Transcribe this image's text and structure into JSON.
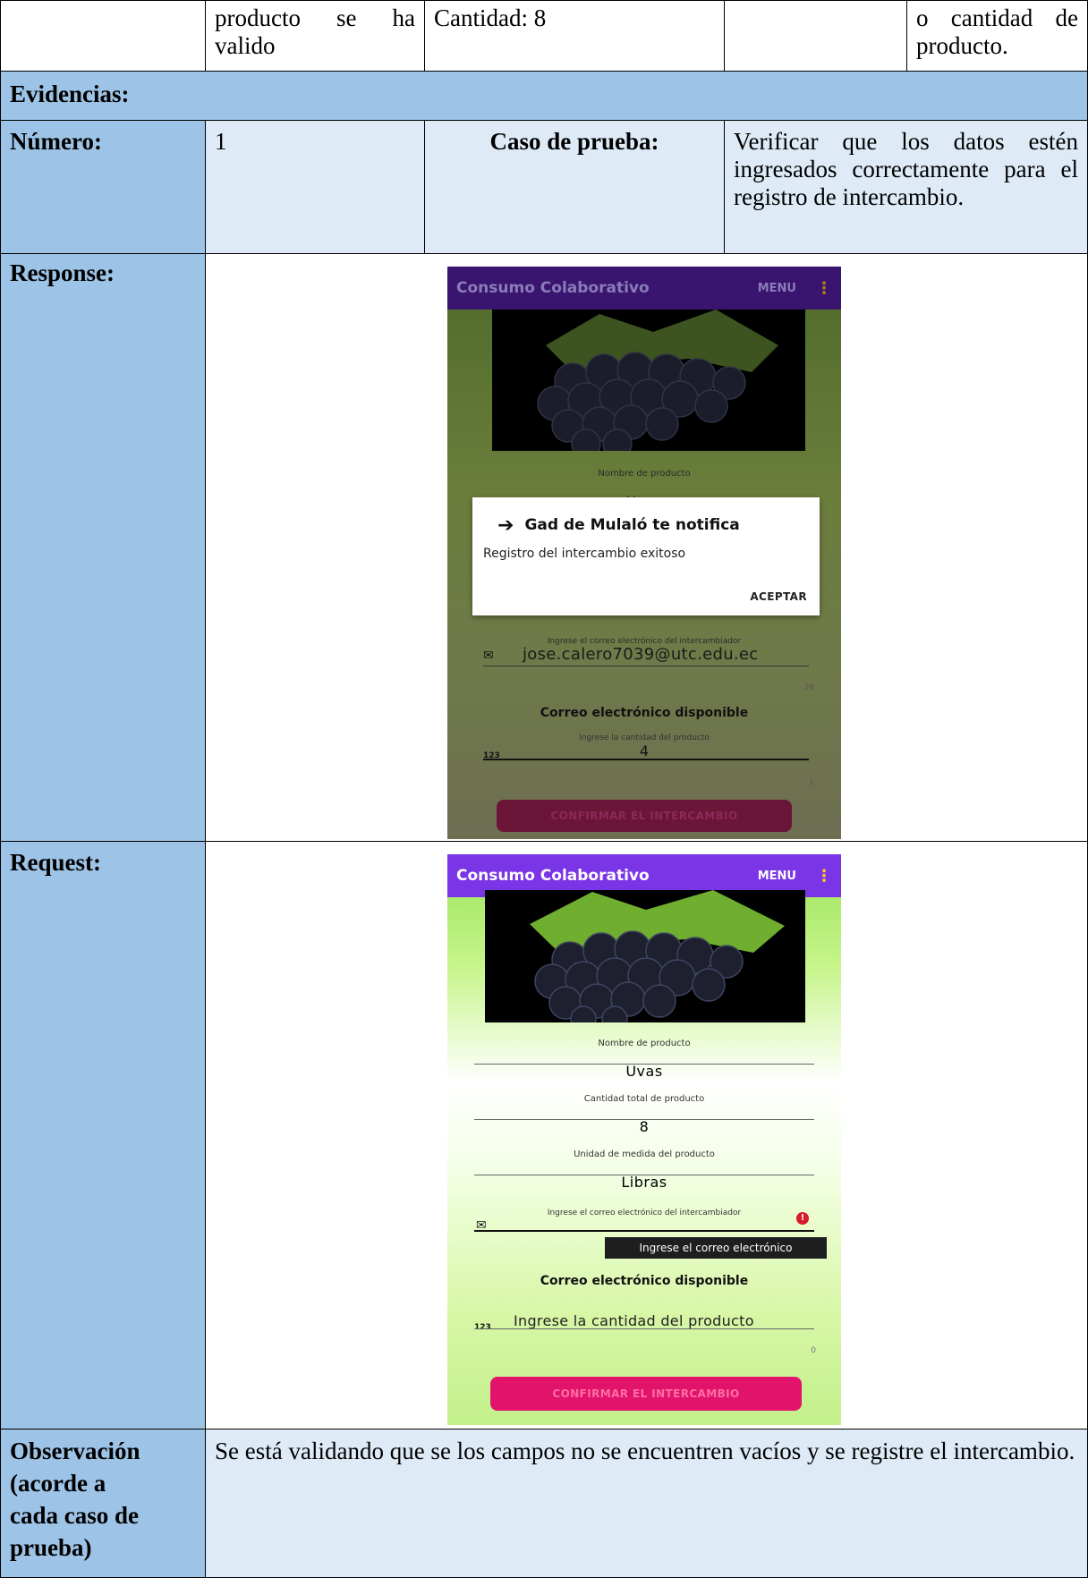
{
  "top_row": {
    "col2": "producto se ha valido",
    "col3": "Cantidad: 8",
    "col4": "",
    "col5": "o cantidad de producto."
  },
  "evidencias_label": "Evidencias:",
  "numero": {
    "label": "Número:",
    "value": "1",
    "caso_label": "Caso de prueba:",
    "caso_value": "Verificar que los datos estén ingresados correctamente para el registro de intercambio."
  },
  "response": {
    "label": "Response:",
    "app_title": "Consumo Colaborativo",
    "menu_label": "MENU",
    "product_name_label": "Nombre de producto",
    "product_name_value": "Uvas",
    "dialog_title": "Gad de Mulaló te notifica",
    "dialog_message": "Registro del intercambio exitoso",
    "dialog_button": "ACEPTAR",
    "email_label": "Ingrese el correo electrónico del intercambiador",
    "email_value": "jose.calero7039@utc.edu.ec",
    "email_counter": "26",
    "email_status": "Correo electrónico disponible",
    "quantity_label": "Ingrese la cantidad del producto",
    "quantity_value": "4",
    "quantity_counter": "1",
    "confirm_button": "CONFIRMAR EL INTERCAMBIO"
  },
  "request": {
    "label": "Request:",
    "app_title": "Consumo Colaborativo",
    "menu_label": "MENU",
    "product_name_label": "Nombre de producto",
    "product_name_value": "Uvas",
    "total_label": "Cantidad total de producto",
    "total_value": "8",
    "unit_label": "Unidad de medida del producto",
    "unit_value": "Libras",
    "email_label": "Ingrese el correo electrónico del intercambiador",
    "error_tooltip": "Ingrese el correo electrónico",
    "email_status": "Correo electrónico disponible",
    "quantity_placeholder": "Ingrese la cantidad del producto",
    "quantity_counter": "0",
    "confirm_button": "CONFIRMAR EL INTERCAMBIO"
  },
  "observacion": {
    "label_line1": "Observación",
    "label_line2": "(acorde a",
    "label_line3": "cada caso de",
    "label_line4": "prueba)",
    "text": "Se está validando que se los campos no se encuentren vacíos y se registre el intercambio."
  },
  "colors": {
    "header_blue": "#9dc3e6",
    "light_blue": "#deebf7",
    "appbar_purple": "#6a2ad8",
    "confirm_pink": "#e2136b"
  },
  "icons": [
    "arrow-right-icon",
    "email-icon",
    "numeric-123-icon",
    "error-icon",
    "overflow-dots-icon"
  ]
}
